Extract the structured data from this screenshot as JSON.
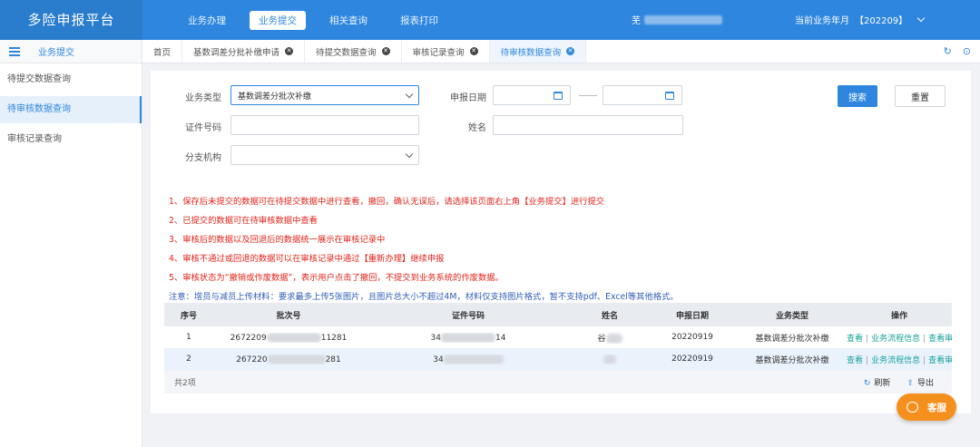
{
  "app": {
    "title": "多险申报平台"
  },
  "nav": {
    "items": [
      "业务办理",
      "业务提交",
      "相关查询",
      "报表打印"
    ],
    "active_index": 1
  },
  "user": {
    "prefix": "芜"
  },
  "period": {
    "label": "当前业务年月",
    "value": "【202209】"
  },
  "sidebar": {
    "header": "业务提交",
    "items": [
      "待提交数据查询",
      "待审核数据查询",
      "审核记录查询"
    ],
    "active_index": 1
  },
  "tabs": {
    "items": [
      "首页",
      "基数调差分批补缴申请",
      "待提交数据查询",
      "审核记录查询",
      "待审核数据查询"
    ],
    "active_index": 4
  },
  "form": {
    "biz_type_label": "业务类型",
    "biz_type_value": "基数调差分批次补缴",
    "date_label": "申报日期",
    "id_label": "证件号码",
    "name_label": "姓名",
    "branch_label": "分支机构",
    "search_label": "搜索",
    "reset_label": "重置"
  },
  "notes": [
    "1、保存后未提交的数据可在待提交数据中进行查看，撤回，确认无误后，请选择该页面右上角【业务提交】进行提交",
    "2、已提交的数据可在待审核数据中查看",
    "3、审核后的数据以及回退后的数据统一展示在审核记录中",
    "4、审核不通过或回退的数据可以在审核记录中通过【重新办理】继续申报",
    "5、审核状态为“撤销或作废数据”，表示用户点击了撤回，不提交到业务系统的作废数据。",
    "注意：增员与减员上传材料：要求最多上传5张图片，且图片总大小不超过4M，材料仅支持图片格式，暂不支持pdf、Excel等其他格式。"
  ],
  "table": {
    "headers": [
      "序号",
      "批次号",
      "证件号码",
      "姓名",
      "申报日期",
      "业务类型",
      "操作"
    ],
    "rows": [
      {
        "no": "1",
        "batch_pre": "2672209",
        "batch_post": "11281",
        "id_pre": "34",
        "id_post": "14",
        "name_pre": "谷",
        "date": "20220919",
        "type": "基数调差分批次补缴"
      },
      {
        "no": "2",
        "batch_pre": "267220",
        "batch_post": "281",
        "id_pre": "34",
        "id_post": "",
        "name_pre": "",
        "date": "20220919",
        "type": "基数调差分批次补缴"
      }
    ],
    "ops": [
      "查看",
      "业务流程信息",
      "查看审核状态"
    ],
    "total": "共2项",
    "refresh": "刷新",
    "export": "导出"
  },
  "support": {
    "label": "客服"
  },
  "colors": {
    "primary": "#2e86de",
    "danger": "#e1251b",
    "accent": "#f5901e"
  }
}
